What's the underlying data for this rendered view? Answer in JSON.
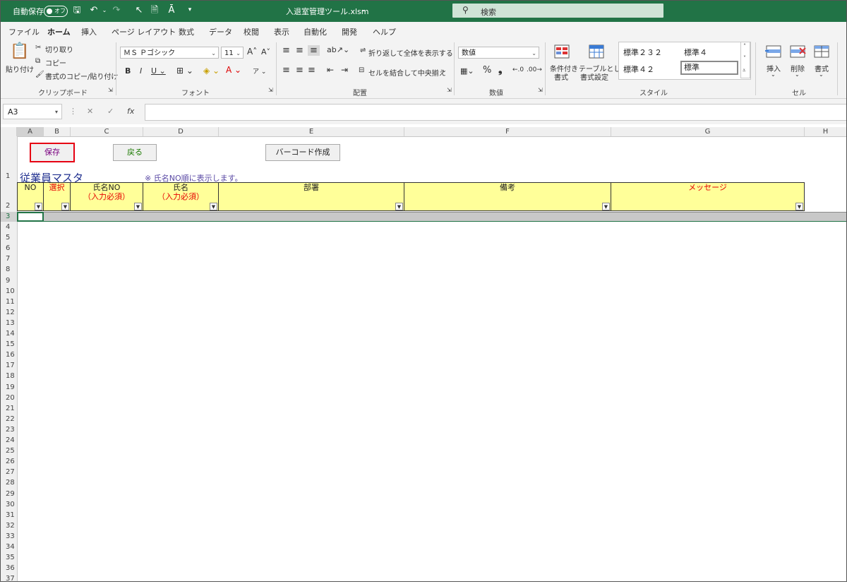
{
  "title_bar": {
    "autosave_label": "自動保存",
    "autosave_state": "オフ",
    "filename": "入退室管理ツール.xlsm",
    "search_placeholder": "検索"
  },
  "ribbon_tabs": [
    "ファイル",
    "ホーム",
    "挿入",
    "ページ レイアウト",
    "数式",
    "データ",
    "校閲",
    "表示",
    "自動化",
    "開発",
    "ヘルプ"
  ],
  "ribbon": {
    "clipboard": {
      "paste": "貼り付け",
      "cut": "切り取り",
      "copy": "コピー",
      "format_painter": "書式のコピー/貼り付け",
      "group": "クリップボード"
    },
    "font": {
      "name": "ＭＳ Ｐゴシック",
      "size": "11",
      "group": "フォント"
    },
    "alignment": {
      "wrap": "折り返して全体を表示する",
      "merge": "セルを結合して中央揃え",
      "group": "配置"
    },
    "number": {
      "format": "数値",
      "group": "数値"
    },
    "styles": {
      "cond_format_1": "条件付き",
      "cond_format_2": "書式",
      "table_1": "テーブルとして",
      "table_2": "書式設定",
      "s1": "標準２３２",
      "s2": "標準４",
      "s3": "標準４２",
      "s4": "標準",
      "group": "スタイル"
    },
    "cells": {
      "insert": "挿入",
      "delete": "削除",
      "format": "書式",
      "group": "セル"
    }
  },
  "formula_bar": {
    "name_box": "A3",
    "fx": "fx"
  },
  "columns": [
    "A",
    "B",
    "C",
    "D",
    "E",
    "F",
    "G",
    "H"
  ],
  "rows": [
    "1",
    "2",
    "3",
    "4",
    "5",
    "6",
    "7",
    "8",
    "9",
    "10",
    "11",
    "12",
    "13",
    "14",
    "15",
    "16",
    "17",
    "18",
    "19",
    "20",
    "21",
    "22",
    "23",
    "24",
    "25",
    "26",
    "27",
    "28",
    "29",
    "30",
    "31",
    "32",
    "33",
    "34",
    "35",
    "36",
    "37"
  ],
  "sheet": {
    "buttons": {
      "save": "保存",
      "back": "戻る",
      "barcode": "バーコード作成"
    },
    "title": "従業員マスタ",
    "note": "※ 氏名NO順に表示します。",
    "headers": {
      "no": "NO",
      "select": "選択",
      "name_no": "氏名NO",
      "name_no_sub": "（入力必須）",
      "name": "氏名",
      "name_sub": "（入力必須）",
      "dept": "部署",
      "remarks": "備考",
      "message": "メッセージ"
    }
  }
}
